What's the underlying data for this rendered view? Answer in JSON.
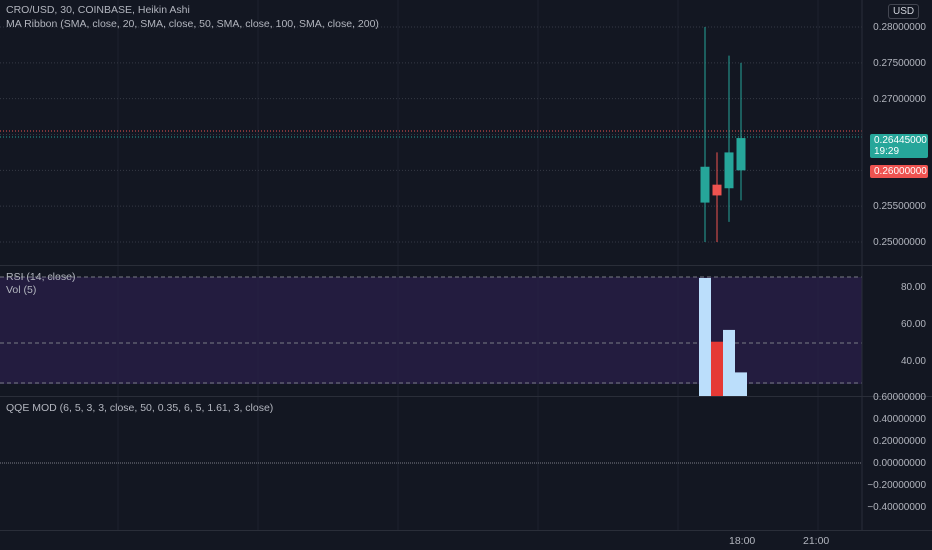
{
  "header": {
    "symbol_line": "CRO/USD, 30, COINBASE, Heikin Ashi",
    "ma_ribbon": "MA Ribbon (SMA, close, 20, SMA, close, 50, SMA, close, 100, SMA, close, 200)",
    "currency": "USD"
  },
  "price_axis": {
    "ticks": [
      "0.28000000",
      "0.27500000",
      "0.27000000",
      "0.25500000",
      "0.25000000"
    ],
    "last_price": "0.26445000",
    "countdown": "19:29",
    "red_tag": "0.26000000"
  },
  "candles": [
    {
      "open": 0.2555,
      "close": 0.2605,
      "high": 0.28,
      "low": 0.25,
      "color": "#26a69a"
    },
    {
      "open": 0.258,
      "close": 0.2565,
      "high": 0.2625,
      "low": 0.25,
      "color": "#ef5350"
    },
    {
      "open": 0.2575,
      "close": 0.2625,
      "high": 0.276,
      "low": 0.2528,
      "color": "#26a69a"
    },
    {
      "open": 0.26,
      "close": 0.2645,
      "high": 0.275,
      "low": 0.2558,
      "color": "#26a69a"
    }
  ],
  "rsi_pane": {
    "title": "RSI (14, close)",
    "vol_title": "Vol (5)",
    "ticks": [
      "80.00",
      "60.00",
      "40.00"
    ],
    "volumes": [
      {
        "value": 100,
        "color": "#bbdefb"
      },
      {
        "value": 46,
        "color": "#e53935"
      },
      {
        "value": 56,
        "color": "#bbdefb"
      },
      {
        "value": 20,
        "color": "#bbdefb"
      }
    ]
  },
  "qqe_pane": {
    "title": "QQE MOD (6, 5, 3, 3, close, 50, 0.35, 6, 5, 1.61, 3, close)",
    "ticks": [
      "0.60000000",
      "0.40000000",
      "0.20000000",
      "0.00000000",
      "−0.20000000",
      "−0.40000000"
    ]
  },
  "time_axis": {
    "ticks": [
      "18:00",
      "21:00"
    ]
  },
  "colors": {
    "up": "#26a69a",
    "down": "#ef5350",
    "background": "#131722",
    "rsi_band": "#2a1f4a"
  }
}
